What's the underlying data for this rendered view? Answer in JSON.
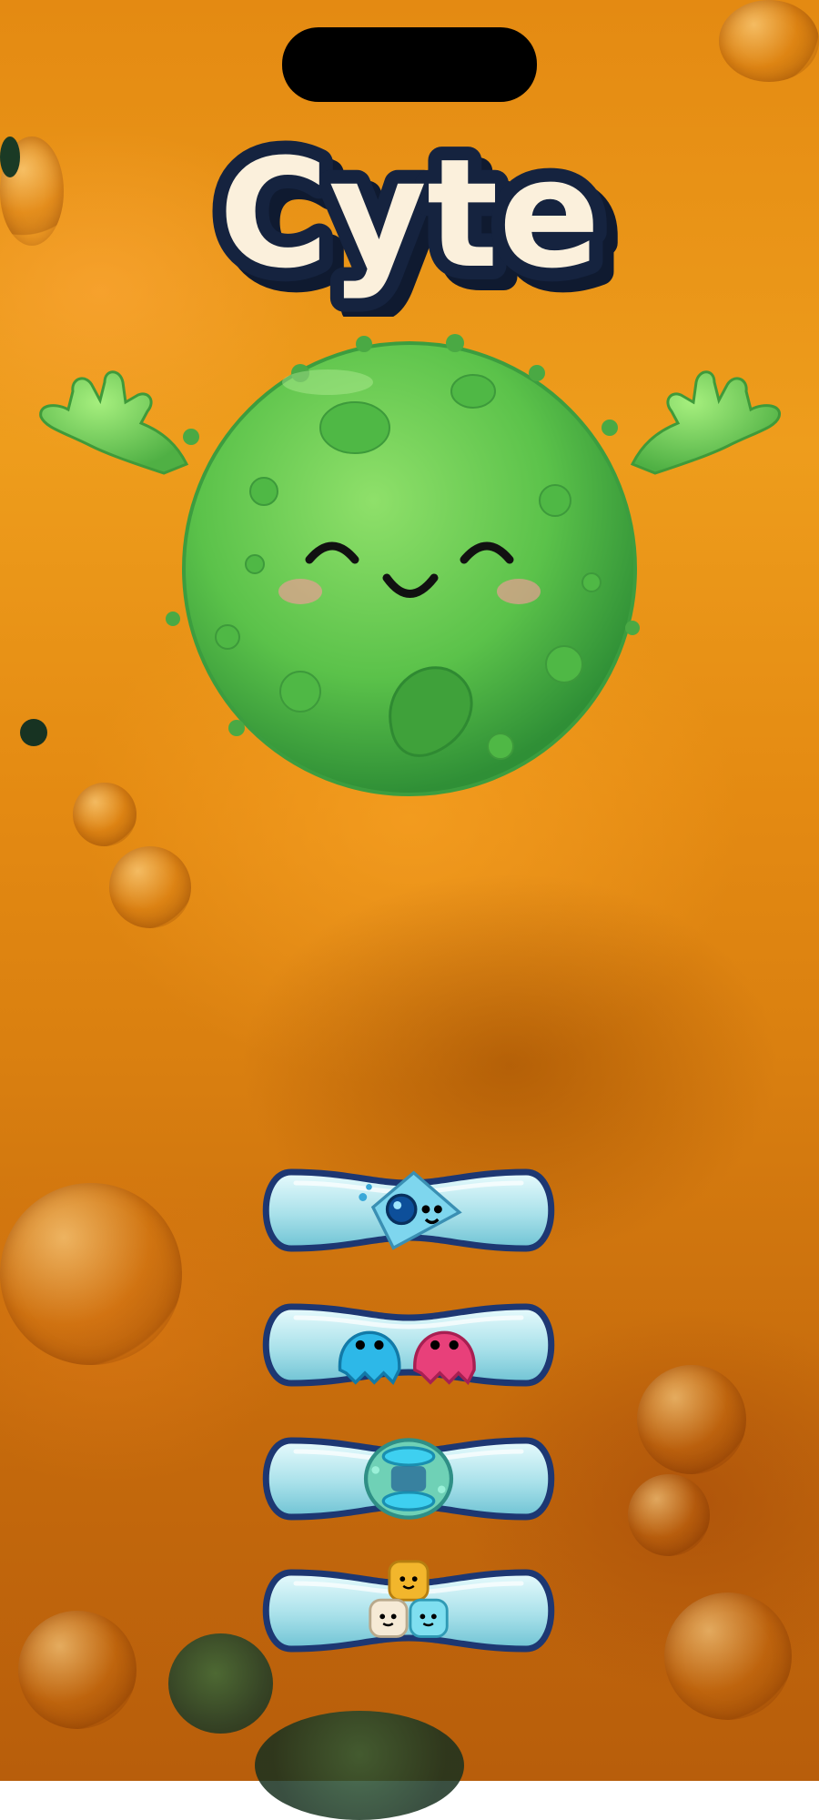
{
  "app": {
    "title": "Cyte"
  },
  "colors": {
    "background": "#e48a12",
    "title_fill": "#fbf0dc",
    "title_outline": "#15233f",
    "cell_green": "#5bc24a",
    "button_fill": "#bfe9ee",
    "button_border": "#1d3772"
  },
  "menu": {
    "buttons": [
      {
        "icon": "blue-comet-icon"
      },
      {
        "icon": "twin-blobs-icon"
      },
      {
        "icon": "cell-capsule-icon"
      },
      {
        "icon": "cube-stack-icon"
      }
    ]
  }
}
